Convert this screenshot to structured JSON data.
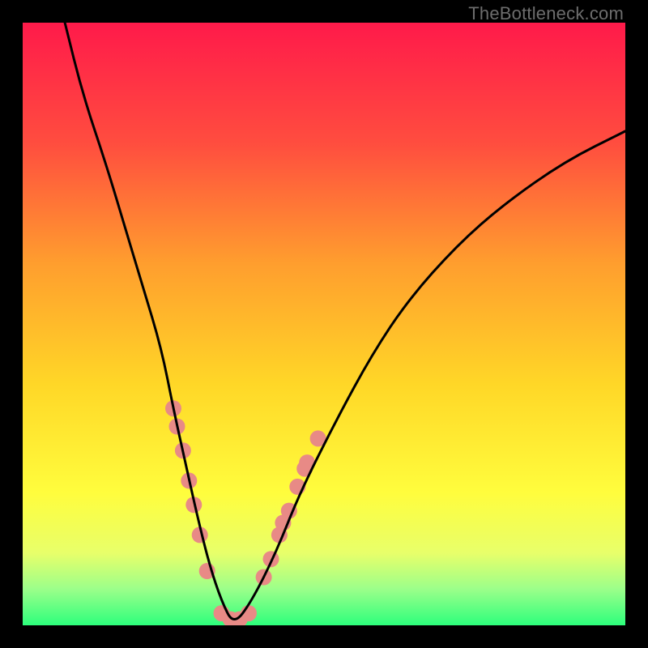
{
  "watermark": "TheBottleneck.com",
  "chart_data": {
    "type": "line",
    "title": "",
    "xlabel": "",
    "ylabel": "",
    "xlim": [
      0,
      100
    ],
    "ylim": [
      0,
      100
    ],
    "grid": false,
    "legend": false,
    "gradient_stops": [
      {
        "offset": 0.0,
        "color": "#ff1a4a"
      },
      {
        "offset": 0.2,
        "color": "#ff4d3f"
      },
      {
        "offset": 0.4,
        "color": "#ff9e2e"
      },
      {
        "offset": 0.6,
        "color": "#ffd727"
      },
      {
        "offset": 0.78,
        "color": "#fffd3d"
      },
      {
        "offset": 0.88,
        "color": "#e8ff6a"
      },
      {
        "offset": 0.94,
        "color": "#9bff8a"
      },
      {
        "offset": 1.0,
        "color": "#2dff7c"
      }
    ],
    "series": [
      {
        "name": "bottleneck-curve",
        "x": [
          7,
          10,
          14,
          17,
          20,
          23,
          25,
          27,
          29,
          31,
          33,
          35,
          38,
          42,
          46,
          52,
          58,
          64,
          72,
          80,
          90,
          100
        ],
        "y": [
          100,
          88,
          76,
          66,
          56,
          46,
          36,
          27,
          18,
          10,
          4,
          0,
          4,
          12,
          22,
          34,
          45,
          54,
          63,
          70,
          77,
          82
        ]
      }
    ],
    "markers": {
      "name": "highlight-dots",
      "color": "#e88a86",
      "radius": 10,
      "points": [
        {
          "x": 25.0,
          "y": 36
        },
        {
          "x": 25.6,
          "y": 33
        },
        {
          "x": 26.6,
          "y": 29
        },
        {
          "x": 27.6,
          "y": 24
        },
        {
          "x": 28.4,
          "y": 20
        },
        {
          "x": 29.4,
          "y": 15
        },
        {
          "x": 30.6,
          "y": 9
        },
        {
          "x": 33.0,
          "y": 2
        },
        {
          "x": 34.5,
          "y": 1
        },
        {
          "x": 36.0,
          "y": 1
        },
        {
          "x": 37.5,
          "y": 2
        },
        {
          "x": 40.0,
          "y": 8
        },
        {
          "x": 41.2,
          "y": 11
        },
        {
          "x": 42.6,
          "y": 15
        },
        {
          "x": 43.2,
          "y": 17
        },
        {
          "x": 44.2,
          "y": 19
        },
        {
          "x": 45.6,
          "y": 23
        },
        {
          "x": 46.8,
          "y": 26
        },
        {
          "x": 47.2,
          "y": 27
        },
        {
          "x": 49.0,
          "y": 31
        }
      ]
    }
  }
}
